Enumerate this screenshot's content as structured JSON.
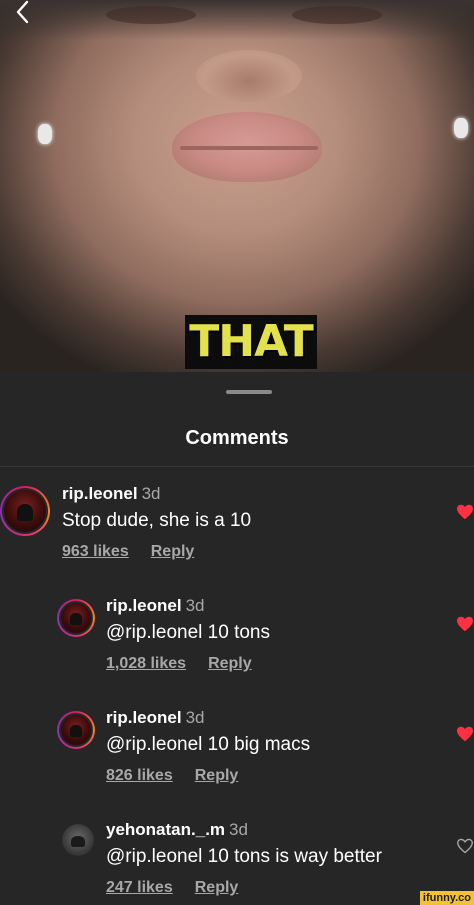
{
  "video": {
    "caption": "THAT"
  },
  "colors": {
    "heart_liked": "#ff3040",
    "caption_text": "#e3e14c",
    "sheet_background": "#262626"
  },
  "icons": {
    "back": "chevron-left-icon",
    "heart_filled": "heart-filled-icon",
    "heart_outline": "heart-outline-icon"
  },
  "sheet": {
    "title": "Comments"
  },
  "comments": [
    {
      "username": "rip.leonel",
      "time": "3d",
      "text": "Stop dude, she is a 10",
      "likes": "963 likes",
      "reply": "Reply",
      "liked": true
    },
    {
      "username": "rip.leonel",
      "time": "3d",
      "text": "@rip.leonel 10 tons",
      "likes": "1,028 likes",
      "reply": "Reply",
      "liked": true
    },
    {
      "username": "rip.leonel",
      "time": "3d",
      "text": "@rip.leonel 10 big macs",
      "likes": "826 likes",
      "reply": "Reply",
      "liked": true
    },
    {
      "username": "yehonatan._.m",
      "time": "3d",
      "text": "@rip.leonel 10 tons is way better",
      "likes": "247 likes",
      "reply": "Reply",
      "liked": false
    }
  ],
  "watermark": "ifunny.co"
}
